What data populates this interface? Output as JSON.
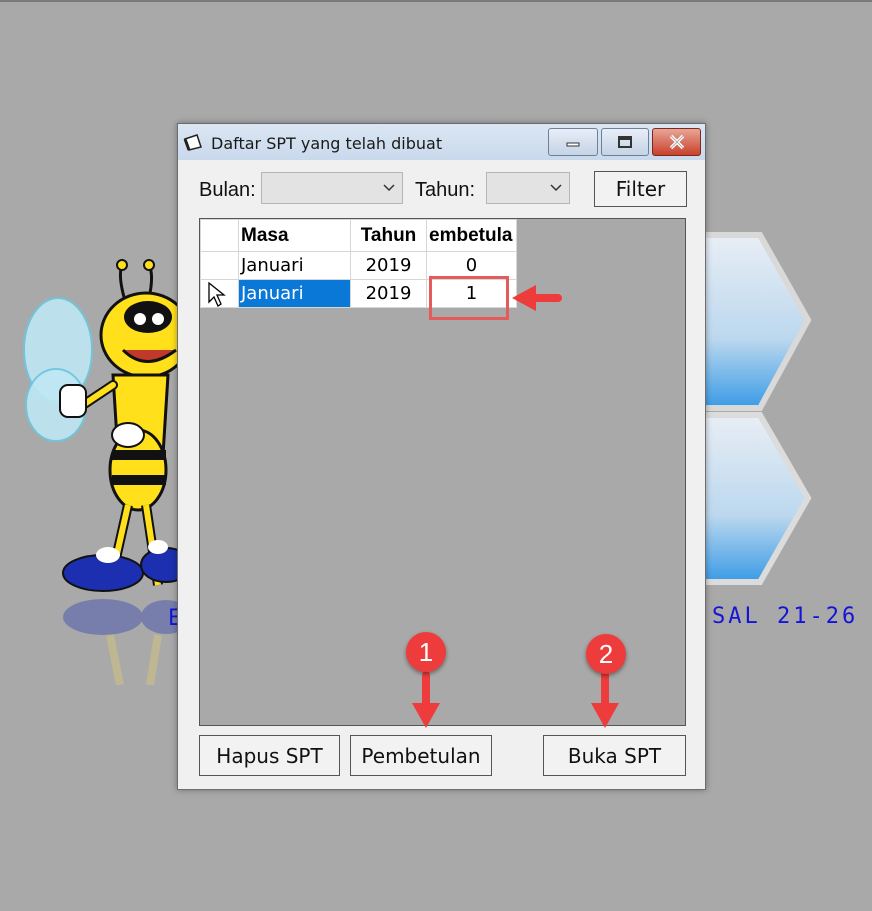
{
  "background": {
    "text_left": "E",
    "text_right": "SAL 21-26"
  },
  "window": {
    "title": "Daftar SPT yang telah dibuat",
    "title_icon": "app-icon",
    "controls": {
      "minimize": "minimize-icon",
      "maximize": "maximize-icon",
      "close": "close-icon"
    }
  },
  "filter": {
    "bulan_label": "Bulan:",
    "bulan_value": "",
    "tahun_label": "Tahun:",
    "tahun_value": "",
    "filter_button": "Filter"
  },
  "grid": {
    "headers": [
      "Masa",
      "Tahun",
      "embetula"
    ],
    "rows": [
      {
        "masa": "Januari",
        "tahun": "2019",
        "pembetulan": "0"
      },
      {
        "masa": "Januari",
        "tahun": "2019",
        "pembetulan": "1"
      }
    ],
    "selected_row": 1
  },
  "buttons": {
    "hapus": "Hapus SPT",
    "pembetulan": "Pembetulan",
    "buka": "Buka SPT"
  },
  "annotations": {
    "marker_1": "1",
    "marker_2": "2",
    "color": "#ee3b3b"
  },
  "colors": {
    "selection": "#0a78d7",
    "desktop": "#a9a9a9",
    "window_bg": "#f0f0f0"
  }
}
